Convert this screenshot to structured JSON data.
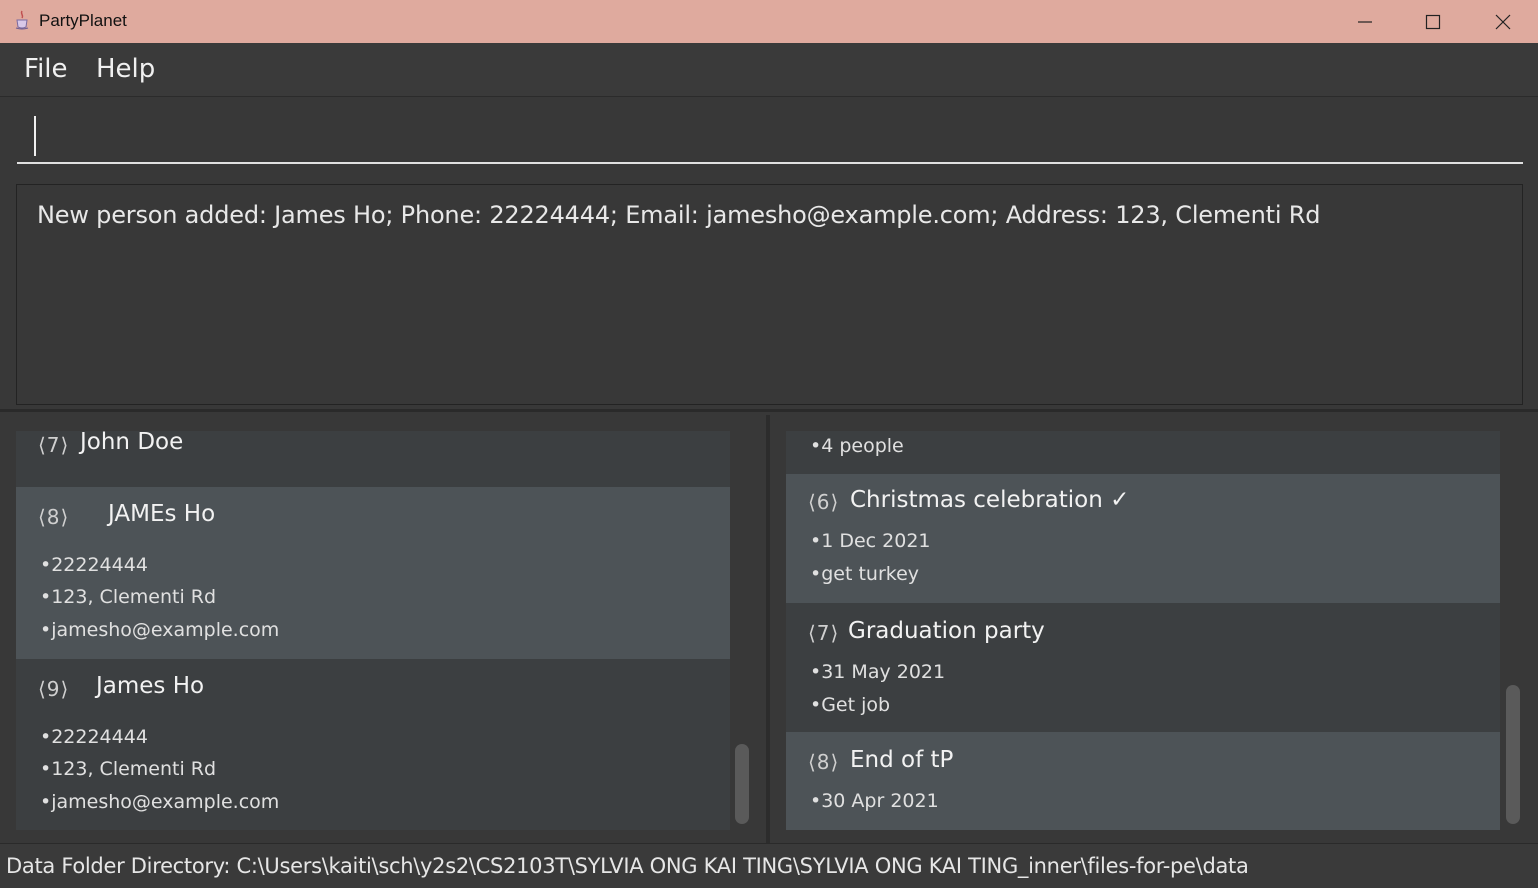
{
  "window": {
    "title": "PartyPlanet",
    "icon": "java-cup-icon"
  },
  "menu": {
    "file": "File",
    "help": "Help"
  },
  "command": {
    "value": "",
    "placeholder": ""
  },
  "result": {
    "message": "New person added: James Ho; Phone: 22224444; Email: jamesho@example.com; Address: 123, Clementi Rd"
  },
  "persons": [
    {
      "index": "⟨7⟩",
      "name": "John Doe",
      "lines": []
    },
    {
      "index": "⟨8⟩",
      "name": "JAMEs Ho",
      "lines": [
        "•22224444",
        "•123, Clementi Rd",
        "•jamesho@example.com"
      ]
    },
    {
      "index": "⟨9⟩",
      "name": "James Ho",
      "lines": [
        "•22224444",
        "•123, Clementi Rd",
        "•jamesho@example.com"
      ]
    }
  ],
  "events": [
    {
      "lines": [
        "•4 people"
      ]
    },
    {
      "index": "⟨6⟩",
      "name": "Christmas celebration ✓",
      "lines": [
        "•1 Dec 2021",
        "•get turkey"
      ]
    },
    {
      "index": "⟨7⟩",
      "name": "Graduation party",
      "lines": [
        "•31 May 2021",
        "•Get job"
      ]
    },
    {
      "index": "⟨8⟩",
      "name": "End of tP",
      "lines": [
        "•30 Apr 2021"
      ]
    }
  ],
  "status": {
    "text": "Data Folder Directory: C:\\Users\\kaiti\\sch\\y2s2\\CS2103T\\SYLVIA ONG KAI TING\\SYLVIA ONG KAI TING_inner\\files-for-pe\\data"
  },
  "colors": {
    "titlebar": "#dfaa9e",
    "background": "#383838",
    "card": "#3c3f41",
    "card_selected": "#4d5357"
  }
}
